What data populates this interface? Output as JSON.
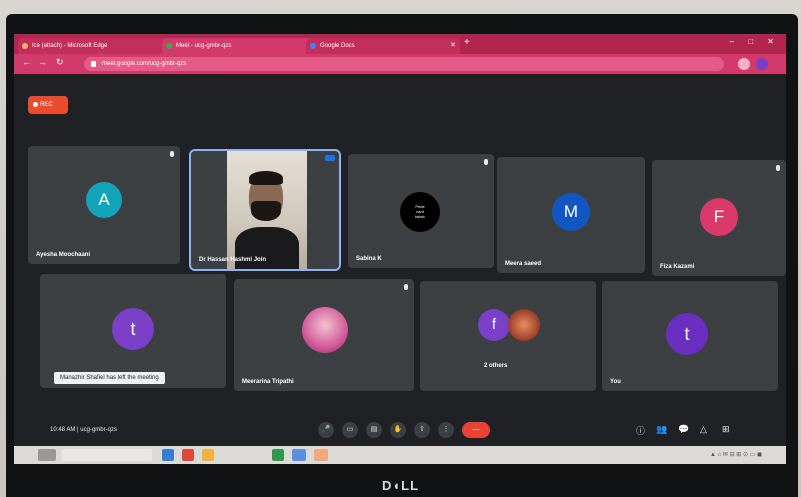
{
  "browser": {
    "tabs": [
      {
        "label": "Ice (attach) - Microsoft Edge",
        "active": false
      },
      {
        "label": "Meet - ucg-gmbr-qzs",
        "active": true
      },
      {
        "label": "Google Docs",
        "active": false
      }
    ],
    "new_tab": "+",
    "window_controls": "– □ ✕",
    "url": "meet.google.com/ucg-gmbr-qzs",
    "theme_color": "#b2254f"
  },
  "meet": {
    "recording_label": "REC",
    "participants": [
      {
        "name": "Ayesha Moochaani",
        "initial": "A",
        "color": "#12a4b8",
        "muted": true
      },
      {
        "name": "Dr Hassan Hashmi  Join",
        "initial": "",
        "color": "",
        "video": true,
        "speaking": true
      },
      {
        "name": "Sabina K",
        "initial": "",
        "color": "#000000",
        "logo_text": "Pride\ncard\nfabric",
        "muted": true
      },
      {
        "name": "Meera saeed",
        "initial": "M",
        "color": "#1256c4",
        "muted": false
      },
      {
        "name": "Fiza Kazami",
        "initial": "F",
        "color": "#d93a6b",
        "muted": true
      },
      {
        "name": "Manazhir Shafiel has left the meeting",
        "initial": "t",
        "color": "#7b3fc8",
        "muted": false
      },
      {
        "name": "Meerarina Tripathi",
        "initial": "",
        "color": "#d35b9a",
        "photo": true,
        "muted": true
      },
      {
        "name": "2 others",
        "initial": "f",
        "color": "#7b3fc8",
        "muted": false
      },
      {
        "name": "You",
        "initial": "t",
        "color": "#6a2fc1",
        "muted": false
      }
    ],
    "meeting_time": "10:48 AM",
    "meeting_code": "ucg-gmbr-qzs",
    "controls": [
      "mic-icon",
      "camera-icon",
      "captions-icon",
      "raise-hand-icon",
      "present-icon",
      "more-icon"
    ],
    "end_call_label": "—",
    "right_controls": [
      "ⓘ",
      "👥",
      "💬",
      "△",
      "⊞"
    ]
  },
  "monitor_brand": "D◖LL"
}
